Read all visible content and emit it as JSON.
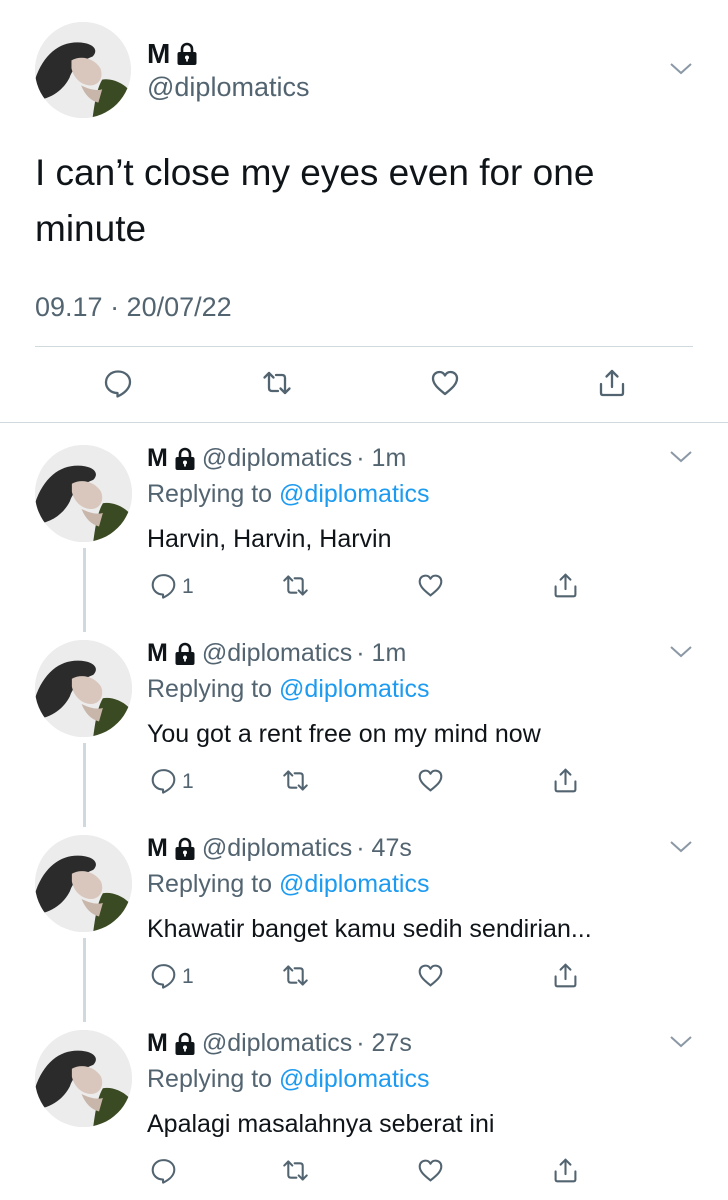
{
  "main_tweet": {
    "name": "M",
    "handle": "@diplomatics",
    "text": "I can’t close my eyes even for one minute",
    "timestamp": "09.17 · 20/07/22"
  },
  "replies": [
    {
      "name": "M",
      "handle": "@diplomatics",
      "time": "· 1m",
      "replying_prefix": "Replying to ",
      "replying_to": "@diplomatics",
      "text": "Harvin, Harvin, Harvin",
      "reply_count": "1"
    },
    {
      "name": "M",
      "handle": "@diplomatics",
      "time": "· 1m",
      "replying_prefix": "Replying to ",
      "replying_to": "@diplomatics",
      "text": "You got a rent free on my mind now",
      "reply_count": "1"
    },
    {
      "name": "M",
      "handle": "@diplomatics",
      "time": "· 47s",
      "replying_prefix": "Replying to ",
      "replying_to": "@diplomatics",
      "text": "Khawatir banget kamu sedih sendirian...",
      "reply_count": "1"
    },
    {
      "name": "M",
      "handle": "@diplomatics",
      "time": "· 27s",
      "replying_prefix": "Replying to ",
      "replying_to": "@diplomatics",
      "text": "Apalagi masalahnya seberat ini",
      "reply_count": ""
    }
  ],
  "icons": {
    "lock": "lock-icon",
    "chevron": "chevron-down-icon",
    "reply": "reply-icon",
    "retweet": "retweet-icon",
    "like": "like-icon",
    "share": "share-icon"
  },
  "colors": {
    "accent": "#1d9bf0",
    "secondary_text": "#536471",
    "divider": "#cfd9de"
  }
}
